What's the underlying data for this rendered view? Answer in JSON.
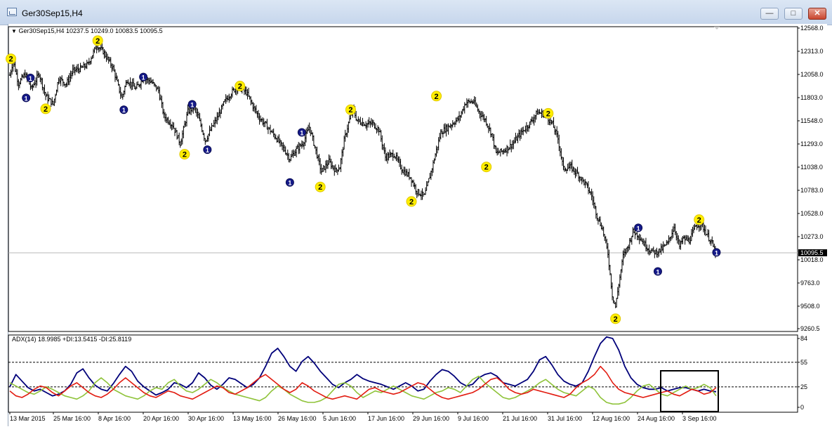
{
  "window": {
    "title": "Ger30Sep15,H4",
    "buttons": {
      "minimize": "—",
      "maximize": "□",
      "close": "✕"
    }
  },
  "main_header": "Ger30Sep15,H4  10237.5 10249.0 10083.5 10095.5",
  "indicator_header": "ADX(14) 18.9985 +DI:13.5415 -DI:25.8119",
  "current_price_label": "10095.5",
  "colors": {
    "adx": "#00007a",
    "plus_di": "#8fc33a",
    "minus_di": "#e21b10",
    "marker_fill": "#ffee00",
    "marker_dark": "#151a8a",
    "price_bar": "#000000"
  },
  "chart_data": [
    {
      "type": "bar",
      "subtype": "ohlc",
      "title": "Ger30Sep15,H4",
      "ylim": [
        9260.5,
        12568.0
      ],
      "y_ticks": [
        "12568.0",
        "12313.0",
        "12058.0",
        "11803.0",
        "11548.0",
        "11293.0",
        "11038.0",
        "10783.0",
        "10528.0",
        "10273.0",
        "10018.0",
        "9763.0",
        "9508.0",
        "9260.5"
      ],
      "current_price": 10095.5,
      "last_ohlc": {
        "open": 10237.5,
        "high": 10249.0,
        "low": 10083.5,
        "close": 10095.5
      },
      "x_ticks": [
        "13 Mar 2015",
        "25 Mar 16:00",
        "8 Apr 16:00",
        "20 Apr 16:00",
        "30 Apr 16:00",
        "13 May 16:00",
        "26 May 16:00",
        "5 Jun 16:00",
        "17 Jun 16:00",
        "29 Jun 16:00",
        "9 Jul 16:00",
        "21 Jul 16:00",
        "31 Jul 16:00",
        "12 Aug 16:00",
        "24 Aug 16:00",
        "3 Sep 16:00"
      ],
      "price_path": [
        [
          0,
          12050
        ],
        [
          3,
          12210
        ],
        [
          8,
          11960
        ],
        [
          14,
          12060
        ],
        [
          20,
          11900
        ],
        [
          27,
          12070
        ],
        [
          33,
          11820
        ],
        [
          40,
          11730
        ],
        [
          45,
          12020
        ],
        [
          52,
          11950
        ],
        [
          58,
          12100
        ],
        [
          65,
          12120
        ],
        [
          72,
          12170
        ],
        [
          80,
          12380
        ],
        [
          86,
          12310
        ],
        [
          95,
          12130
        ],
        [
          103,
          11800
        ],
        [
          108,
          12000
        ],
        [
          116,
          11900
        ],
        [
          123,
          12020
        ],
        [
          130,
          11980
        ],
        [
          137,
          11880
        ],
        [
          142,
          11600
        ],
        [
          150,
          11500
        ],
        [
          157,
          11300
        ],
        [
          164,
          11650
        ],
        [
          170,
          11700
        ],
        [
          176,
          11500
        ],
        [
          180,
          11330
        ],
        [
          186,
          11470
        ],
        [
          192,
          11600
        ],
        [
          198,
          11760
        ],
        [
          205,
          11870
        ],
        [
          210,
          11920
        ],
        [
          218,
          11860
        ],
        [
          224,
          11710
        ],
        [
          230,
          11580
        ],
        [
          238,
          11470
        ],
        [
          246,
          11350
        ],
        [
          254,
          11210
        ],
        [
          258,
          11130
        ],
        [
          264,
          11230
        ],
        [
          270,
          11300
        ],
        [
          276,
          11480
        ],
        [
          281,
          11260
        ],
        [
          287,
          10990
        ],
        [
          294,
          11100
        ],
        [
          300,
          11000
        ],
        [
          304,
          11040
        ],
        [
          308,
          11330
        ],
        [
          312,
          11520
        ],
        [
          316,
          11680
        ],
        [
          320,
          11550
        ],
        [
          328,
          11510
        ],
        [
          334,
          11520
        ],
        [
          340,
          11450
        ],
        [
          346,
          11150
        ],
        [
          354,
          11180
        ],
        [
          362,
          11000
        ],
        [
          369,
          10930
        ],
        [
          375,
          10770
        ],
        [
          382,
          10720
        ],
        [
          389,
          11030
        ],
        [
          397,
          11420
        ],
        [
          406,
          11500
        ],
        [
          414,
          11580
        ],
        [
          420,
          11750
        ],
        [
          427,
          11760
        ],
        [
          432,
          11650
        ],
        [
          438,
          11560
        ],
        [
          444,
          11400
        ],
        [
          448,
          11190
        ],
        [
          455,
          11220
        ],
        [
          463,
          11290
        ],
        [
          470,
          11400
        ],
        [
          479,
          11520
        ],
        [
          486,
          11640
        ],
        [
          493,
          11620
        ],
        [
          500,
          11510
        ],
        [
          505,
          11350
        ],
        [
          510,
          11020
        ],
        [
          517,
          11040
        ],
        [
          524,
          10950
        ],
        [
          531,
          10840
        ],
        [
          536,
          10720
        ],
        [
          541,
          10500
        ],
        [
          546,
          10360
        ],
        [
          551,
          10090
        ],
        [
          555,
          9630
        ],
        [
          558,
          9500
        ],
        [
          561,
          9750
        ],
        [
          565,
          10060
        ],
        [
          570,
          10180
        ],
        [
          574,
          10330
        ],
        [
          579,
          10290
        ],
        [
          584,
          10200
        ],
        [
          590,
          10120
        ],
        [
          595,
          10100
        ],
        [
          600,
          10130
        ],
        [
          606,
          10200
        ],
        [
          612,
          10380
        ],
        [
          617,
          10160
        ],
        [
          620,
          10250
        ],
        [
          626,
          10230
        ],
        [
          632,
          10390
        ],
        [
          637,
          10420
        ],
        [
          642,
          10300
        ],
        [
          647,
          10200
        ],
        [
          650,
          10095
        ]
      ],
      "range_pct": 0.026,
      "seed": 7,
      "fractal_markers": [
        {
          "i": 1,
          "price": 12230,
          "label": "2",
          "kind": "high"
        },
        {
          "i": 15,
          "price": 11800,
          "label": "1",
          "kind": "low"
        },
        {
          "i": 19,
          "price": 12020,
          "label": "1",
          "kind": "high"
        },
        {
          "i": 33,
          "price": 11680,
          "label": "2",
          "kind": "low"
        },
        {
          "i": 81,
          "price": 12430,
          "label": "2",
          "kind": "high"
        },
        {
          "i": 105,
          "price": 11670,
          "label": "1",
          "kind": "low"
        },
        {
          "i": 123,
          "price": 12030,
          "label": "1",
          "kind": "high"
        },
        {
          "i": 161,
          "price": 11180,
          "label": "2",
          "kind": "low"
        },
        {
          "i": 168,
          "price": 11730,
          "label": "1",
          "kind": "high"
        },
        {
          "i": 182,
          "price": 11230,
          "label": "1",
          "kind": "low"
        },
        {
          "i": 212,
          "price": 11930,
          "label": "2",
          "kind": "high"
        },
        {
          "i": 258,
          "price": 10870,
          "label": "1",
          "kind": "low"
        },
        {
          "i": 269,
          "price": 11420,
          "label": "1",
          "kind": "high"
        },
        {
          "i": 286,
          "price": 10820,
          "label": "2",
          "kind": "low"
        },
        {
          "i": 314,
          "price": 11670,
          "label": "2",
          "kind": "high"
        },
        {
          "i": 370,
          "price": 10660,
          "label": "2",
          "kind": "low"
        },
        {
          "i": 393,
          "price": 11820,
          "label": "2",
          "kind": "high"
        },
        {
          "i": 439,
          "price": 11040,
          "label": "2",
          "kind": "low"
        },
        {
          "i": 496,
          "price": 11630,
          "label": "2",
          "kind": "high"
        },
        {
          "i": 558,
          "price": 9370,
          "label": "2",
          "kind": "low"
        },
        {
          "i": 579,
          "price": 10370,
          "label": "1",
          "kind": "high"
        },
        {
          "i": 597,
          "price": 9890,
          "label": "1",
          "kind": "low"
        },
        {
          "i": 635,
          "price": 10460,
          "label": "2",
          "kind": "high"
        },
        {
          "i": 651,
          "price": 10100,
          "label": "1",
          "kind": "low"
        }
      ]
    },
    {
      "type": "line",
      "title": "ADX(14) 18.9985 +DI:13.5415 -DI:25.8119",
      "ylim": [
        0,
        84
      ],
      "y_ticks": [
        "84",
        "55",
        "25",
        "0"
      ],
      "levels": [
        55,
        25
      ],
      "series": [
        {
          "name": "ADX(14)",
          "color": "#00007a",
          "values": [
            25,
            40,
            32,
            24,
            20,
            22,
            18,
            14,
            16,
            20,
            28,
            42,
            47,
            36,
            27,
            22,
            20,
            29,
            40,
            50,
            44,
            32,
            25,
            20,
            15,
            18,
            22,
            30,
            28,
            24,
            30,
            42,
            36,
            27,
            22,
            28,
            36,
            34,
            29,
            24,
            28,
            36,
            50,
            66,
            72,
            62,
            50,
            44,
            56,
            62,
            54,
            44,
            36,
            28,
            24,
            30,
            34,
            40,
            35,
            32,
            30,
            28,
            25,
            22,
            26,
            30,
            26,
            20,
            22,
            32,
            40,
            46,
            44,
            38,
            30,
            26,
            28,
            36,
            40,
            42,
            38,
            30,
            28,
            26,
            30,
            34,
            44,
            58,
            62,
            52,
            40,
            32,
            28,
            26,
            30,
            44,
            62,
            78,
            86,
            84,
            70,
            50,
            36,
            28,
            24,
            22,
            22,
            24,
            20,
            22,
            24,
            24,
            22,
            20,
            22,
            20,
            19
          ]
        },
        {
          "name": "+DI",
          "color": "#8fc33a",
          "values": [
            30,
            26,
            22,
            18,
            16,
            20,
            25,
            22,
            18,
            14,
            12,
            10,
            14,
            20,
            30,
            36,
            30,
            22,
            18,
            14,
            12,
            10,
            14,
            20,
            24,
            22,
            30,
            34,
            26,
            20,
            18,
            22,
            28,
            34,
            30,
            24,
            20,
            16,
            14,
            12,
            10,
            8,
            12,
            20,
            26,
            22,
            16,
            12,
            8,
            6,
            6,
            8,
            12,
            20,
            28,
            30,
            26,
            18,
            12,
            16,
            20,
            18,
            22,
            26,
            22,
            18,
            14,
            12,
            10,
            14,
            18,
            20,
            24,
            22,
            18,
            26,
            34,
            38,
            30,
            24,
            18,
            12,
            10,
            12,
            16,
            20,
            24,
            30,
            34,
            28,
            22,
            18,
            16,
            14,
            20,
            26,
            22,
            12,
            6,
            4,
            4,
            6,
            12,
            20,
            26,
            28,
            22,
            16,
            14,
            18,
            22,
            26,
            22,
            24,
            28,
            24,
            14
          ]
        },
        {
          "name": "-DI",
          "color": "#e21b10",
          "values": [
            20,
            14,
            12,
            16,
            22,
            26,
            24,
            18,
            14,
            20,
            26,
            30,
            24,
            18,
            14,
            12,
            16,
            22,
            30,
            36,
            30,
            24,
            18,
            14,
            12,
            16,
            20,
            18,
            14,
            12,
            10,
            14,
            18,
            22,
            26,
            24,
            18,
            16,
            20,
            24,
            30,
            36,
            40,
            34,
            28,
            22,
            18,
            22,
            30,
            26,
            20,
            16,
            12,
            10,
            12,
            14,
            12,
            10,
            16,
            22,
            24,
            20,
            18,
            16,
            18,
            22,
            26,
            30,
            28,
            22,
            16,
            12,
            10,
            12,
            14,
            16,
            18,
            22,
            28,
            34,
            36,
            30,
            22,
            18,
            16,
            18,
            22,
            20,
            18,
            16,
            14,
            12,
            16,
            24,
            30,
            34,
            40,
            50,
            42,
            30,
            22,
            18,
            16,
            14,
            12,
            14,
            16,
            18,
            20,
            16,
            14,
            18,
            22,
            20,
            16,
            18,
            24
          ]
        }
      ]
    }
  ]
}
